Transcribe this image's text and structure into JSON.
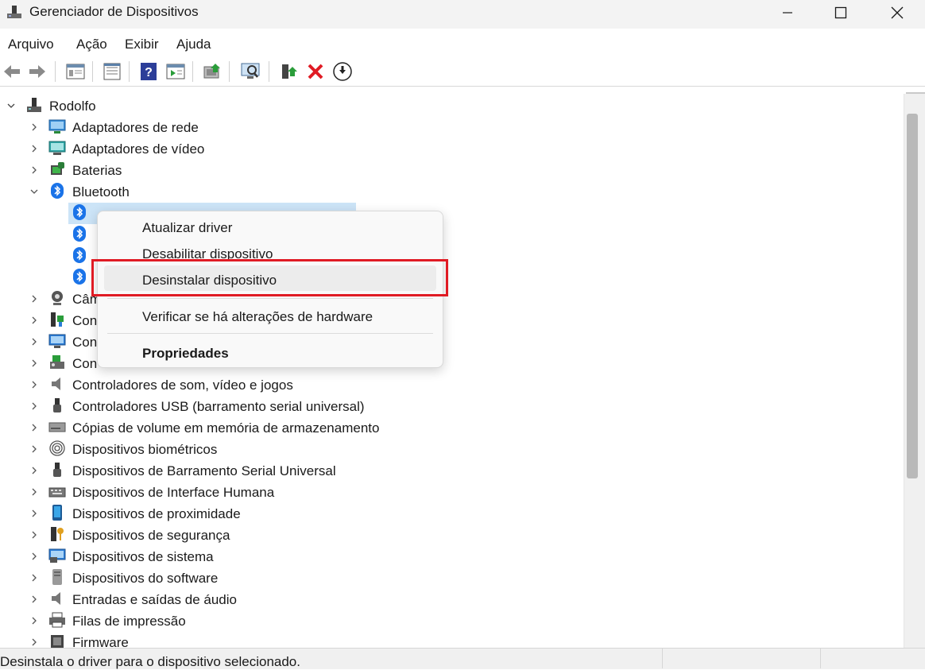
{
  "window": {
    "title": "Gerenciador de Dispositivos"
  },
  "menubar": {
    "items": [
      "Arquivo",
      "Ação",
      "Exibir",
      "Ajuda"
    ]
  },
  "toolbar": {
    "buttons": [
      "back-icon",
      "forward-icon",
      "show-hide-console-icon",
      "properties-icon",
      "help-icon",
      "action-pane-icon",
      "update-driver-icon",
      "scan-hardware-icon",
      "enable-device-icon",
      "uninstall-device-icon",
      "download-driver-icon"
    ]
  },
  "tree": {
    "root": "Rodolfo",
    "items": [
      {
        "label": "Adaptadores de rede",
        "icon": "network-adapter-icon"
      },
      {
        "label": "Adaptadores de vídeo",
        "icon": "display-adapter-icon"
      },
      {
        "label": "Baterias",
        "icon": "battery-icon"
      },
      {
        "label": "Bluetooth",
        "icon": "bluetooth-icon",
        "expanded": true
      },
      {
        "label": "Câm",
        "icon": "camera-icon"
      },
      {
        "label": "Con",
        "icon": "controller-icon"
      },
      {
        "label": "Con",
        "icon": "monitor-icon"
      },
      {
        "label": "Con",
        "icon": "storage-controller-icon"
      },
      {
        "label": "Controladores de som, vídeo e jogos",
        "icon": "speaker-icon"
      },
      {
        "label": "Controladores USB (barramento serial universal)",
        "icon": "usb-icon"
      },
      {
        "label": "Cópias de volume em memória de armazenamento",
        "icon": "drive-icon"
      },
      {
        "label": "Dispositivos biométricos",
        "icon": "fingerprint-icon"
      },
      {
        "label": "Dispositivos de Barramento Serial Universal",
        "icon": "usb-icon"
      },
      {
        "label": "Dispositivos de Interface Humana",
        "icon": "keyboard-icon"
      },
      {
        "label": "Dispositivos de proximidade",
        "icon": "phone-icon"
      },
      {
        "label": "Dispositivos de segurança",
        "icon": "key-icon"
      },
      {
        "label": "Dispositivos de sistema",
        "icon": "system-icon"
      },
      {
        "label": "Dispositivos do software",
        "icon": "software-icon"
      },
      {
        "label": "Entradas e saídas de áudio",
        "icon": "speaker-icon"
      },
      {
        "label": "Filas de impressão",
        "icon": "printer-icon"
      },
      {
        "label": "Firmware",
        "icon": "firmware-icon"
      }
    ],
    "bluetooth_children_count": 4
  },
  "context_menu": {
    "items": [
      {
        "label": "Atualizar driver",
        "bold": false
      },
      {
        "label": "Desabilitar dispositivo",
        "bold": false
      },
      {
        "label": "Desinstalar dispositivo",
        "bold": false,
        "highlighted": true
      },
      {
        "label": "Verificar se há alterações de hardware",
        "bold": false
      },
      {
        "label": "Propriedades",
        "bold": true
      }
    ]
  },
  "statusbar": {
    "text": "Desinstala o driver para o dispositivo selecionado."
  },
  "colors": {
    "highlight_border": "#e01b24",
    "selection": "#cce4f7",
    "bluetooth": "#1a73e8"
  }
}
